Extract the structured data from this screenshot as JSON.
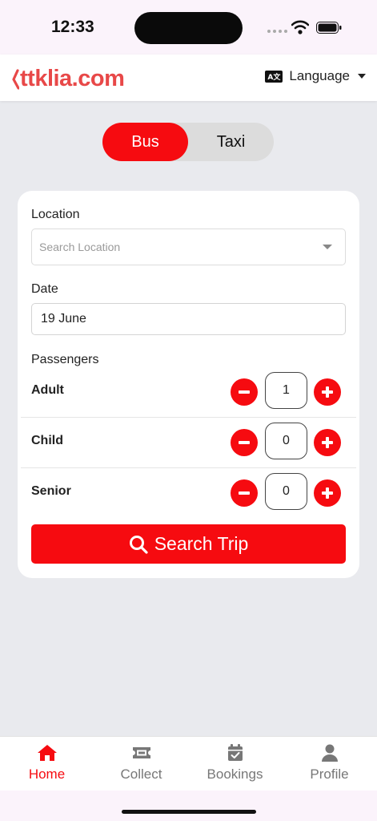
{
  "status": {
    "time": "12:33"
  },
  "header": {
    "brand": "ttklia.com",
    "language_label": "Language",
    "language_icon_text": "A文",
    "brand_color": "#e84848"
  },
  "mode_toggle": {
    "options": [
      "Bus",
      "Taxi"
    ],
    "selected": "Bus",
    "accent_color": "#f60b10"
  },
  "form": {
    "location_label": "Location",
    "location_placeholder": "Search Location",
    "date_label": "Date",
    "date_value": "19 June",
    "passengers_label": "Passengers",
    "passengers": [
      {
        "name": "Adult",
        "count": "1"
      },
      {
        "name": "Child",
        "count": "0"
      },
      {
        "name": "Senior",
        "count": "0"
      }
    ],
    "search_button_label": "Search Trip"
  },
  "tabs": [
    {
      "label": "Home",
      "icon": "home-icon",
      "active": true
    },
    {
      "label": "Collect",
      "icon": "ticket-icon",
      "active": false
    },
    {
      "label": "Bookings",
      "icon": "calendar-check-icon",
      "active": false
    },
    {
      "label": "Profile",
      "icon": "user-icon",
      "active": false
    }
  ]
}
